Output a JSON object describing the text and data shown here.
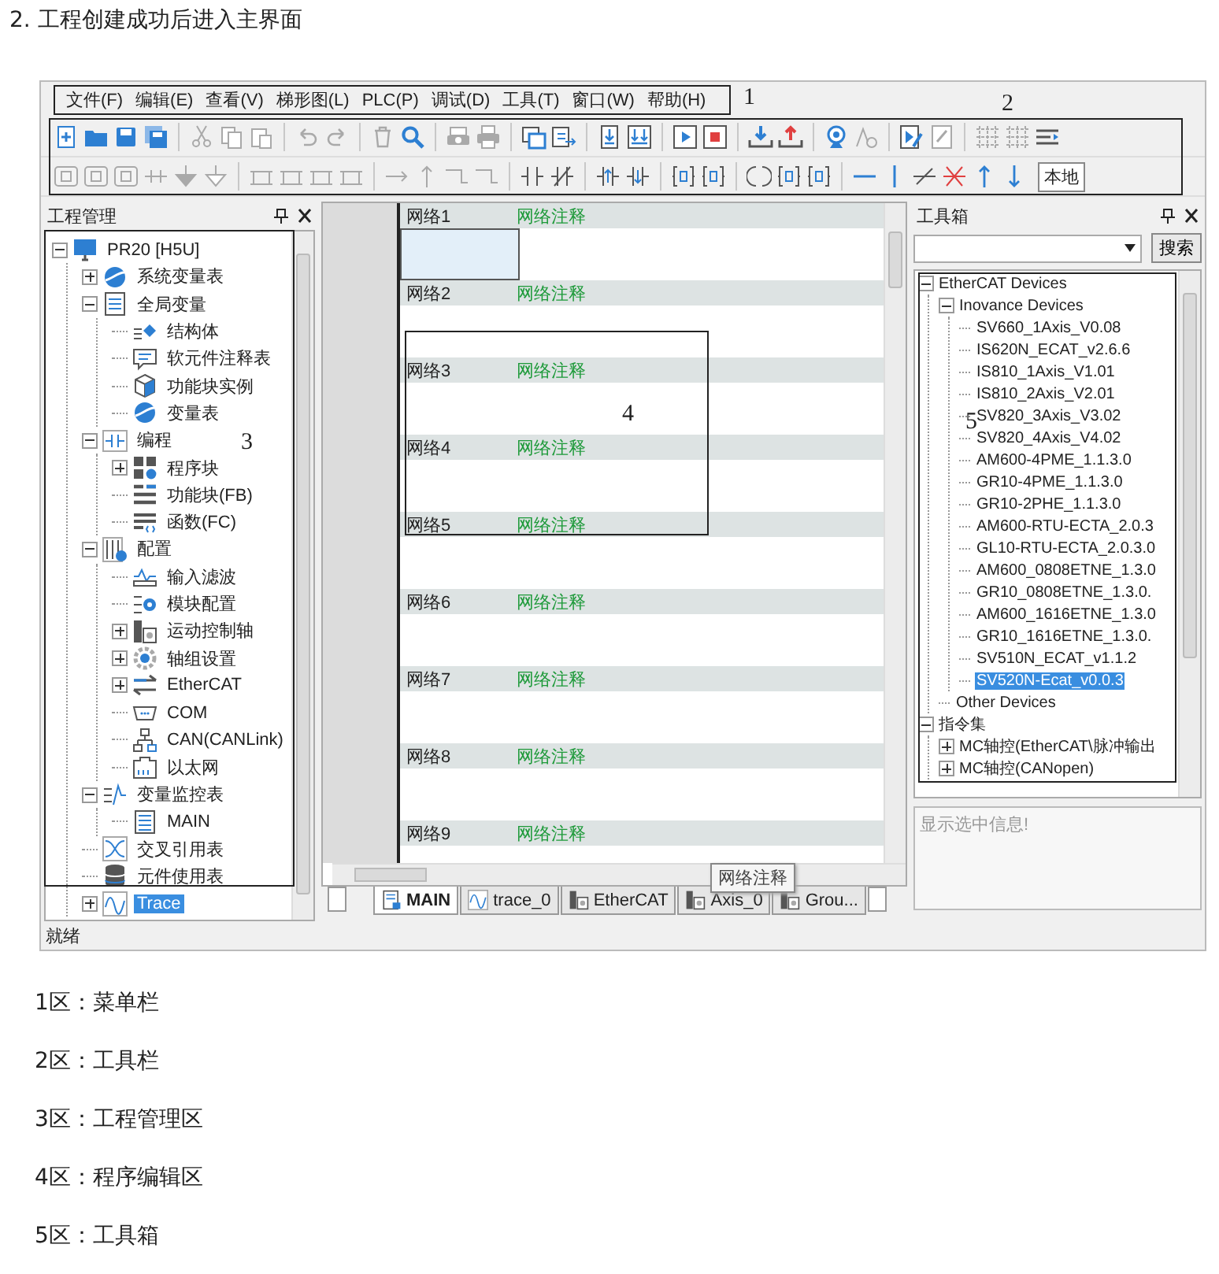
{
  "heading": "2. 工程创建成功后进入主界面",
  "app": {
    "menu": {
      "items": [
        "文件(F)",
        "编辑(E)",
        "查看(V)",
        "梯形图(L)",
        "PLC(P)",
        "调试(D)",
        "工具(T)",
        "窗口(W)",
        "帮助(H)"
      ],
      "annotation": "1"
    },
    "toolbar": {
      "annotation": "2",
      "field_text": "本地"
    },
    "project_panel": {
      "title": "工程管理",
      "annotation": "3",
      "tree": [
        {
          "label": "PR20 [H5U]",
          "expanded": true,
          "selected": false,
          "children": [
            {
              "label": "系统变量表",
              "expanded": false,
              "selected": false
            },
            {
              "label": "全局变量",
              "expanded": true,
              "selected": false,
              "children": [
                {
                  "label": "结构体",
                  "selected": false
                },
                {
                  "label": "软元件注释表",
                  "selected": false
                },
                {
                  "label": "功能块实例",
                  "selected": false
                },
                {
                  "label": "变量表",
                  "selected": false
                }
              ]
            },
            {
              "label": "编程",
              "expanded": true,
              "selected": false,
              "children": [
                {
                  "label": "程序块",
                  "expanded": false,
                  "selected": false
                },
                {
                  "label": "功能块(FB)",
                  "selected": false
                },
                {
                  "label": "函数(FC)",
                  "selected": false
                }
              ]
            },
            {
              "label": "配置",
              "expanded": true,
              "selected": false,
              "children": [
                {
                  "label": "输入滤波",
                  "selected": false
                },
                {
                  "label": "模块配置",
                  "selected": false
                },
                {
                  "label": "运动控制轴",
                  "expanded": false,
                  "selected": false
                },
                {
                  "label": "轴组设置",
                  "expanded": false,
                  "selected": false
                },
                {
                  "label": "EtherCAT",
                  "expanded": false,
                  "selected": false
                },
                {
                  "label": "COM",
                  "selected": false
                },
                {
                  "label": "CAN(CANLink)",
                  "selected": false
                },
                {
                  "label": "以太网",
                  "selected": false
                }
              ]
            },
            {
              "label": "变量监控表",
              "expanded": true,
              "selected": false,
              "children": [
                {
                  "label": "MAIN",
                  "selected": false
                }
              ]
            },
            {
              "label": "交叉引用表",
              "selected": false
            },
            {
              "label": "元件使用表",
              "selected": false
            },
            {
              "label": "Trace",
              "expanded": false,
              "selected": true
            }
          ]
        }
      ]
    },
    "editor": {
      "annotation": "4",
      "networks": [
        {
          "label": "网络1",
          "comment": "网络注释",
          "selected": true
        },
        {
          "label": "网络2",
          "comment": "网络注释",
          "selected": false
        },
        {
          "label": "网络3",
          "comment": "网络注释",
          "selected": false
        },
        {
          "label": "网络4",
          "comment": "网络注释",
          "selected": false
        },
        {
          "label": "网络5",
          "comment": "网络注释",
          "selected": false
        },
        {
          "label": "网络6",
          "comment": "网络注释",
          "selected": false
        },
        {
          "label": "网络7",
          "comment": "网络注释",
          "selected": false
        },
        {
          "label": "网络8",
          "comment": "网络注释",
          "selected": false
        },
        {
          "label": "网络9",
          "comment": "网络注释",
          "selected": false
        }
      ],
      "tabs": [
        {
          "label": "MAIN",
          "selected": true
        },
        {
          "label": "trace_0",
          "selected": false
        },
        {
          "label": "EtherCAT",
          "selected": false
        },
        {
          "label": "Axis_0",
          "selected": false
        },
        {
          "label": "Grou...",
          "selected": false
        }
      ],
      "tooltip": "网络注释"
    },
    "toolbox": {
      "title": "工具箱",
      "search_button": "搜索",
      "annotation": "5",
      "tree": [
        {
          "label": "EtherCAT Devices",
          "expanded": true,
          "selected": false,
          "children": [
            {
              "label": "Inovance Devices",
              "expanded": true,
              "selected": false,
              "children": [
                {
                  "label": "SV660_1Axis_V0.08",
                  "selected": false
                },
                {
                  "label": "IS620N_ECAT_v2.6.6",
                  "selected": false
                },
                {
                  "label": "IS810_1Axis_V1.01",
                  "selected": false
                },
                {
                  "label": "IS810_2Axis_V2.01",
                  "selected": false
                },
                {
                  "label": "SV820_3Axis_V3.02",
                  "selected": false
                },
                {
                  "label": "SV820_4Axis_V4.02",
                  "selected": false
                },
                {
                  "label": "AM600-4PME_1.1.3.0",
                  "selected": false
                },
                {
                  "label": "GR10-4PME_1.1.3.0",
                  "selected": false
                },
                {
                  "label": "GR10-2PHE_1.1.3.0",
                  "selected": false
                },
                {
                  "label": "AM600-RTU-ECTA_2.0.3",
                  "selected": false
                },
                {
                  "label": "GL10-RTU-ECTA_2.0.3.0",
                  "selected": false
                },
                {
                  "label": "AM600_0808ETNE_1.3.0",
                  "selected": false
                },
                {
                  "label": "GR10_0808ETNE_1.3.0.",
                  "selected": false
                },
                {
                  "label": "AM600_1616ETNE_1.3.0",
                  "selected": false
                },
                {
                  "label": "GR10_1616ETNE_1.3.0.",
                  "selected": false
                },
                {
                  "label": "SV510N_ECAT_v1.1.2",
                  "selected": false
                },
                {
                  "label": "SV520N-Ecat_v0.0.3",
                  "selected": true
                }
              ]
            },
            {
              "label": "Other Devices",
              "selected": false
            }
          ]
        },
        {
          "label": "指令集",
          "expanded": true,
          "selected": false,
          "children": [
            {
              "label": "MC轴控(EtherCAT\\脉冲输出",
              "expanded": false,
              "selected": false
            },
            {
              "label": "MC轴控(CANopen)",
              "expanded": false,
              "selected": false
            }
          ]
        }
      ],
      "info_placeholder": "显示选中信息!"
    },
    "status": "就绪"
  },
  "legend": [
    "1区：菜单栏",
    "2区：工具栏",
    "3区：工程管理区",
    "4区：程序编辑区",
    "5区：工具箱"
  ]
}
